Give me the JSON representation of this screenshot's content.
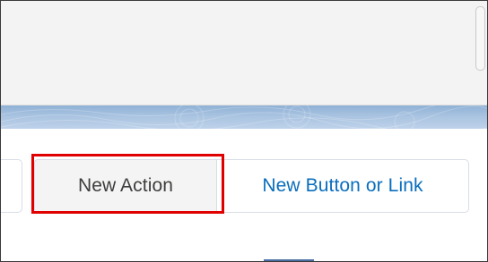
{
  "buttons": {
    "new_action_label": "New Action",
    "new_button_or_link_label": "New Button or Link"
  },
  "colors": {
    "highlight": "#e00000",
    "link_blue": "#0a6ebd",
    "band_blue": "#a9c3e0"
  }
}
